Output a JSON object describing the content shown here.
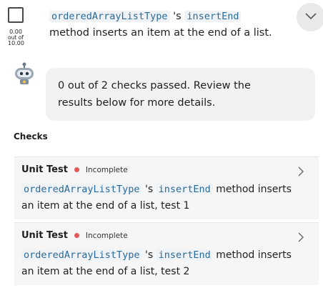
{
  "question": {
    "score_value": "0.00",
    "score_out_of": "out of",
    "score_total": "10.00",
    "code_class": "orderedArrayListType",
    "text_possessive": " 's ",
    "code_method": "insertEnd",
    "text_rest": "method inserts an item at the end of a list."
  },
  "result": {
    "summary": "0 out of 2 checks passed. Review the results below for more details."
  },
  "checks": {
    "heading": "Checks",
    "items": [
      {
        "label": "Unit Test",
        "status": "Incomplete",
        "code_class": "orderedArrayListType",
        "text_possessive": " 's ",
        "code_method": "insertEnd",
        "text_rest": " method inserts an item at the end of a list, test 1"
      },
      {
        "label": "Unit Test",
        "status": "Incomplete",
        "code_class": "orderedArrayListType",
        "text_possessive": " 's ",
        "code_method": "insertEnd",
        "text_rest": " method inserts an item at the end of a list, test 2"
      }
    ]
  },
  "colors": {
    "status_incomplete": "#e25a5a",
    "code_text": "#2a6a9a"
  },
  "icons": {
    "expand": "chevron-down-icon",
    "assistant": "robot-icon",
    "open_check": "chevron-right-icon"
  }
}
